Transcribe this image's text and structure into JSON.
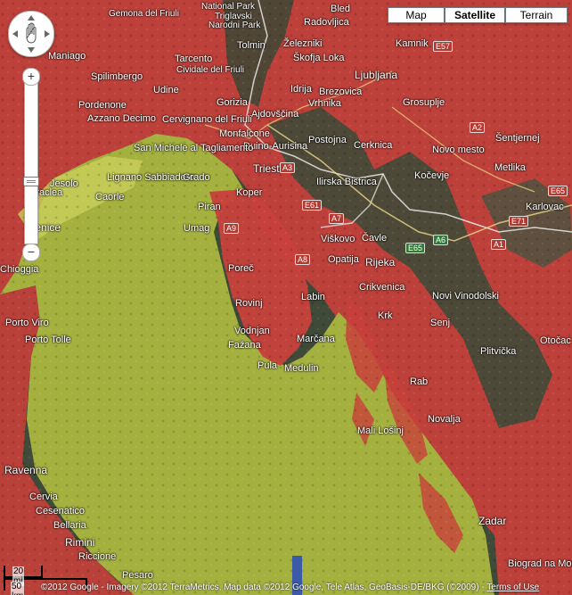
{
  "map_types": [
    {
      "label": "Map",
      "selected": false
    },
    {
      "label": "Satellite",
      "selected": true
    },
    {
      "label": "Terrain",
      "selected": false
    }
  ],
  "zoom": {
    "plus": "+",
    "minus": "−"
  },
  "scale": {
    "short": "20 mi",
    "long": "50 km"
  },
  "attribution": {
    "text": "©2012 Google - Imagery ©2012 TerraMetrics, Map data ©2012 Google, Tele Atlas, GeoBasis-DE/BKG (©2009) - ",
    "terms": "Terms of Use"
  },
  "places": [
    "National Park",
    "Gemona del Friuli",
    "Triglavski",
    "Narodni Park",
    "Bled",
    "Radovljica",
    "Cividale del Friuli",
    "Tolmin",
    "Železniki",
    "Kamnik",
    "Škofja Loka",
    "Ljubljana",
    "Udine",
    "Idrija",
    "Vrhnika",
    "Brezovica",
    "Grosuplje",
    "Gorizia",
    "Ajdovščina",
    "Pordenone",
    "Cervignano del Friuli",
    "Postojna",
    "Cerknica",
    "Monfalcone",
    "Duino-Aurisina",
    "Trieste",
    "Kočevje",
    "Novo mesto",
    "San Michele al Tagliamento",
    "Lignano Sabbiadoro",
    "Grado",
    "Ilirska Bistrica",
    "Metlika",
    "Jesolo",
    "Eraclea",
    "Caorle",
    "Koper",
    "Karlovac",
    "Piran",
    "Umag",
    "Viškovo",
    "Čavle",
    "Rijeka",
    "Opatija",
    "Venice",
    "Chioggia",
    "Poreč",
    "Rovinj",
    "Labin",
    "Crikvenica",
    "Novi Vinodolski",
    "Krk",
    "Senj",
    "Porto Viro",
    "Porto Tolle",
    "Vodnjan",
    "Fažana",
    "Marčana",
    "Pula",
    "Medulin",
    "Otočac",
    "Plitvička",
    "Rab",
    "Novalja",
    "Mali Lošinj",
    "Ravenna",
    "Cervia",
    "Cesenatico",
    "Bellaria",
    "Rimini",
    "Riccione",
    "Pesaro",
    "Zadar",
    "Biograd na Moru",
    "Šentjernej",
    "Spilimbergo",
    "Maniago",
    "Azzano Decimo",
    "Tarcento"
  ],
  "routes": [
    "A3",
    "E61",
    "A7",
    "A9",
    "E65",
    "A6",
    "A8",
    "A1",
    "E71",
    "A2",
    "E57",
    "E65"
  ]
}
